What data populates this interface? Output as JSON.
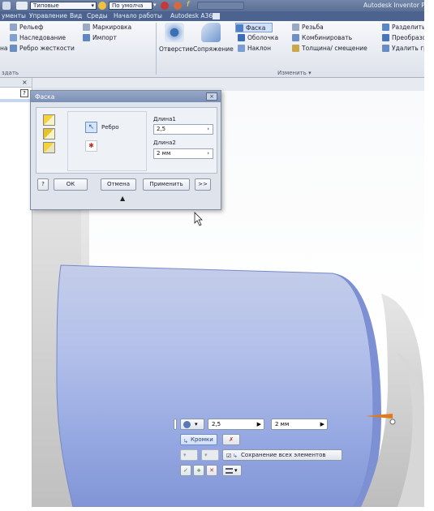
{
  "qat": {
    "dropdown1": "Типовые",
    "dropdown2": "По умолча",
    "app_title": "Autodesk Inventor P"
  },
  "tabs": [
    "ументы",
    "Управление",
    "Вид",
    "Среды",
    "Начало работы",
    "Autodesk A360"
  ],
  "ribbon": {
    "col1": [
      "Рельеф",
      "Наследование",
      "Ребро жесткости"
    ],
    "col1_prefix": "на",
    "col2": [
      "Маркировка",
      "Импорт"
    ],
    "big_buttons": [
      "Отверстие",
      "Сопряжение"
    ],
    "col3": [
      "Фаска",
      "Оболочка",
      "Наклон"
    ],
    "col4": [
      "Резьба",
      "Комбинировать",
      "Толщина/ смещение"
    ],
    "col5": [
      "Разделить",
      "Преобразов",
      "Удалить гран"
    ],
    "group_left": "здать",
    "group_modify": "Изменить ▾"
  },
  "browser": {
    "close": "×",
    "help": "?"
  },
  "dialog": {
    "title": "Фаска",
    "close": "×",
    "edges_label": "Ребро",
    "length1_label": "Длина1",
    "length1_value": "2,5",
    "length2_label": "Длина2",
    "length2_value": "2 мм",
    "help": "?",
    "ok": "ОК",
    "cancel": "Отмена",
    "apply": "Применить",
    "more": ">>",
    "expand": "▲"
  },
  "minitoolbar": {
    "length1": "2,5",
    "length2": "2 мм",
    "edges_btn": "Кромки",
    "keep_all": "Сохранение всех элементов",
    "ok": "✓",
    "apply": "+",
    "cancel": "✕"
  },
  "colors": {
    "accent": "#4c6390",
    "selection": "#8fa3e3",
    "model": "#d9d9dc"
  }
}
